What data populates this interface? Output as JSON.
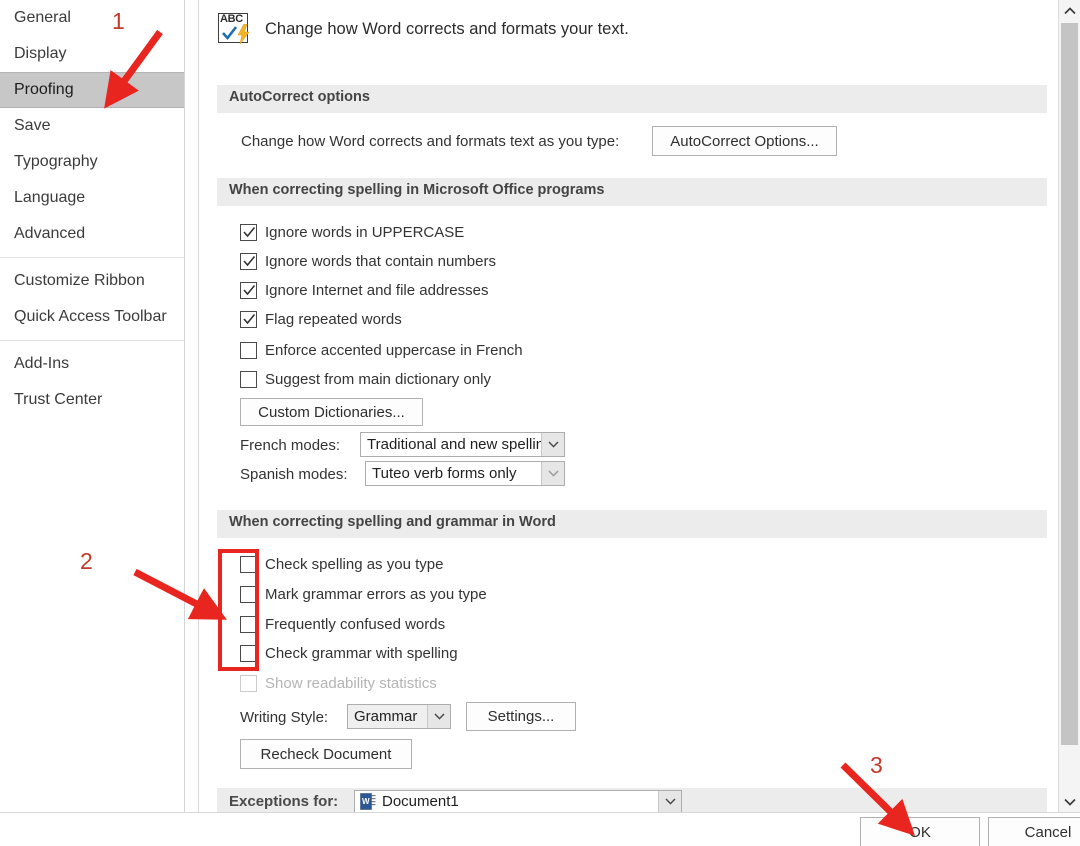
{
  "sidebar": {
    "groups": [
      {
        "items": [
          {
            "label": "General",
            "selected": false
          },
          {
            "label": "Display",
            "selected": false
          },
          {
            "label": "Proofing",
            "selected": true
          },
          {
            "label": "Save",
            "selected": false
          },
          {
            "label": "Typography",
            "selected": false
          },
          {
            "label": "Language",
            "selected": false
          },
          {
            "label": "Advanced",
            "selected": false
          }
        ]
      },
      {
        "items": [
          {
            "label": "Customize Ribbon",
            "selected": false
          },
          {
            "label": "Quick Access Toolbar",
            "selected": false
          }
        ]
      },
      {
        "items": [
          {
            "label": "Add-Ins",
            "selected": false
          },
          {
            "label": "Trust Center",
            "selected": false
          }
        ]
      }
    ]
  },
  "intro": {
    "icon": "abc-spellcheck-icon",
    "text": "Change how Word corrects and formats your text."
  },
  "autocorrect": {
    "band_title": "AutoCorrect options",
    "row_label": "Change how Word corrects and formats text as you type:",
    "button_label": "AutoCorrect Options..."
  },
  "office_spelling": {
    "band_title": "When correcting spelling in Microsoft Office programs",
    "checkboxes": [
      {
        "label": "Ignore words in UPPERCASE",
        "checked": true,
        "enabled": true
      },
      {
        "label": "Ignore words that contain numbers",
        "checked": true,
        "enabled": true
      },
      {
        "label": "Ignore Internet and file addresses",
        "checked": true,
        "enabled": true
      },
      {
        "label": "Flag repeated words",
        "checked": true,
        "enabled": true
      },
      {
        "label": "Enforce accented uppercase in French",
        "checked": false,
        "enabled": true
      },
      {
        "label": "Suggest from main dictionary only",
        "checked": false,
        "enabled": true
      }
    ],
    "custom_dictionaries_button": "Custom Dictionaries...",
    "french_modes_label": "French modes:",
    "french_modes_value": "Traditional and new spellings",
    "spanish_modes_label": "Spanish modes:",
    "spanish_modes_value": "Tuteo verb forms only"
  },
  "word_grammar": {
    "band_title": "When correcting spelling and grammar in Word",
    "checkboxes": [
      {
        "label": "Check spelling as you type",
        "checked": false,
        "enabled": true
      },
      {
        "label": "Mark grammar errors as you type",
        "checked": false,
        "enabled": true
      },
      {
        "label": "Frequently confused words",
        "checked": false,
        "enabled": true
      },
      {
        "label": "Check grammar with spelling",
        "checked": false,
        "enabled": true
      },
      {
        "label": "Show readability statistics",
        "checked": false,
        "enabled": false
      }
    ],
    "writing_style_label": "Writing Style:",
    "writing_style_value": "Grammar",
    "settings_button": "Settings...",
    "recheck_button": "Recheck Document"
  },
  "exceptions": {
    "label": "Exceptions for:",
    "value": "Document1",
    "icon": "word-document-icon"
  },
  "footer": {
    "ok_label": "OK",
    "cancel_label": "Cancel"
  },
  "scrollbar": {
    "up_icon": "chevron-up-icon",
    "down_icon": "chevron-down-icon"
  },
  "annotations": {
    "accent_color": "#e8251f",
    "number_color": "#c0392b",
    "markers": [
      {
        "number": "1",
        "target": "sidebar-item-proofing"
      },
      {
        "number": "2",
        "target": "grammar-checkbox-group"
      },
      {
        "number": "3",
        "target": "ok-button"
      }
    ],
    "highlight_box": {
      "target": "grammar-checkbox-group",
      "color": "#e8251f"
    }
  }
}
